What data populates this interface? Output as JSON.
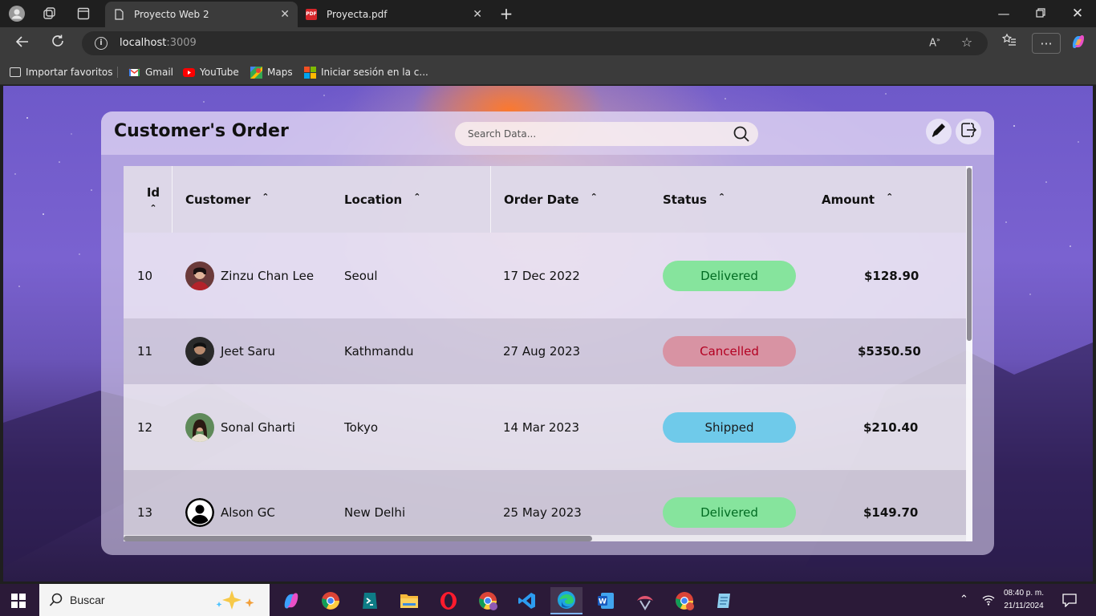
{
  "browser": {
    "tabs": [
      {
        "title": "Proyecto Web 2",
        "active": true
      },
      {
        "title": "Proyecta.pdf",
        "active": false
      }
    ],
    "url_host": "localhost",
    "url_port": ":3009",
    "bookmarks": [
      "Importar favoritos",
      "Gmail",
      "YouTube",
      "Maps",
      "Iniciar sesión en la c..."
    ]
  },
  "app": {
    "title": "Customer's Order",
    "search_placeholder": "Search Data...",
    "columns": [
      {
        "label": "Id",
        "sort_icon": "⌃"
      },
      {
        "label": "Customer",
        "sort_icon": "⌃"
      },
      {
        "label": "Location",
        "sort_icon": "⌃"
      },
      {
        "label": "Order Date",
        "sort_icon": "⌃"
      },
      {
        "label": "Status",
        "sort_icon": "⌃"
      },
      {
        "label": "Amount",
        "sort_icon": "⌃"
      }
    ],
    "rows": [
      {
        "id": "10",
        "customer": "Zinzu Chan Lee",
        "location": "Seoul",
        "date": "17 Dec 2022",
        "status": "Delivered",
        "amount": "$128.90"
      },
      {
        "id": "11",
        "customer": "Jeet Saru",
        "location": "Kathmandu",
        "date": "27 Aug 2023",
        "status": "Cancelled",
        "amount": "$5350.50"
      },
      {
        "id": "12",
        "customer": "Sonal Gharti",
        "location": "Tokyo",
        "date": "14 Mar 2023",
        "status": "Shipped",
        "amount": "$210.40"
      },
      {
        "id": "13",
        "customer": "Alson GC",
        "location": "New Delhi",
        "date": "25 May 2023",
        "status": "Delivered",
        "amount": "$149.70"
      }
    ],
    "status_colors": {
      "Delivered": {
        "bg": "#86e49d",
        "fg": "#006b21"
      },
      "Cancelled": {
        "bg": "#d893a3",
        "fg": "#b30021"
      },
      "Shipped": {
        "bg": "#6fcaea",
        "fg": "#1a1a1a"
      }
    }
  },
  "taskbar": {
    "search_label": "Buscar",
    "time": "08:40 p. m.",
    "date": "21/11/2024"
  }
}
